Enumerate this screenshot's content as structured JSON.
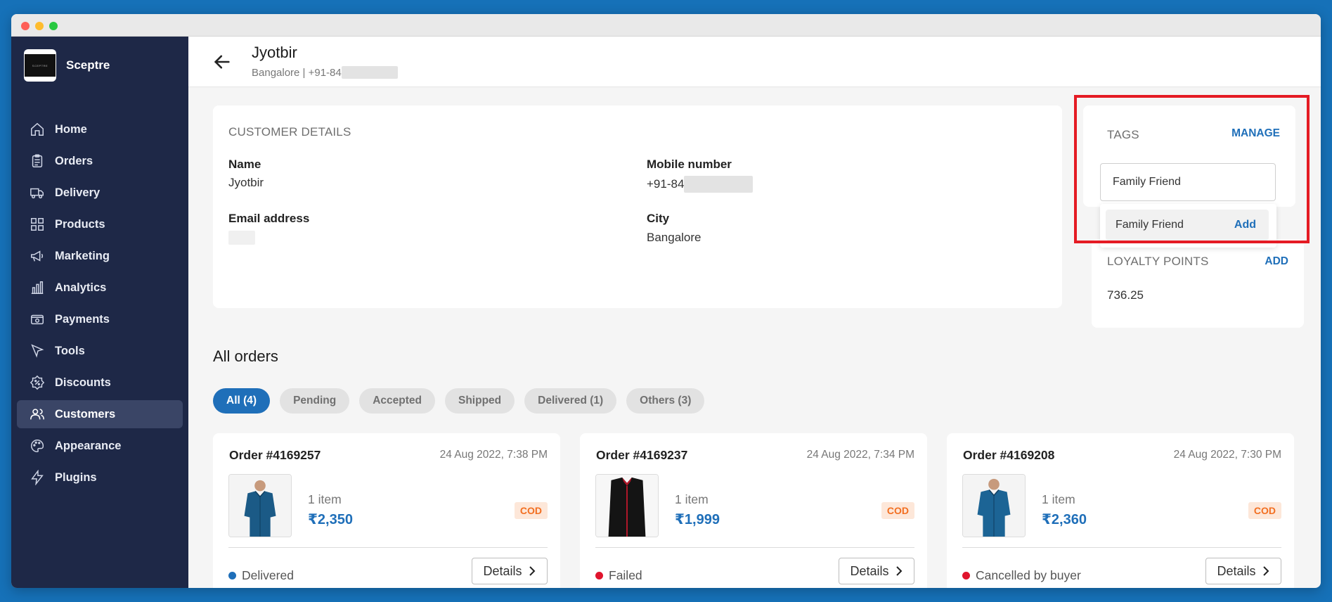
{
  "app": {
    "brand": "Sceptre",
    "logo_text": "SCEPTRE"
  },
  "sidebar": {
    "items": [
      {
        "label": "Home",
        "icon": "home-icon"
      },
      {
        "label": "Orders",
        "icon": "clipboard-icon"
      },
      {
        "label": "Delivery",
        "icon": "truck-icon"
      },
      {
        "label": "Products",
        "icon": "grid-icon"
      },
      {
        "label": "Marketing",
        "icon": "megaphone-icon"
      },
      {
        "label": "Analytics",
        "icon": "bar-chart-icon"
      },
      {
        "label": "Payments",
        "icon": "wallet-icon"
      },
      {
        "label": "Tools",
        "icon": "cursor-arrow-icon"
      },
      {
        "label": "Discounts",
        "icon": "discount-badge-icon"
      },
      {
        "label": "Customers",
        "icon": "users-icon",
        "active": true
      },
      {
        "label": "Appearance",
        "icon": "palette-icon"
      },
      {
        "label": "Plugins",
        "icon": "lightning-icon"
      }
    ]
  },
  "header": {
    "name": "Jyotbir",
    "subtitle": "Bangalore | +91-84"
  },
  "customer_details": {
    "section_title": "CUSTOMER DETAILS",
    "name_label": "Name",
    "name_value": "Jyotbir",
    "mobile_label": "Mobile number",
    "mobile_value": "+91-84",
    "email_label": "Email address",
    "city_label": "City",
    "city_value": "Bangalore"
  },
  "tags": {
    "title": "TAGS",
    "manage": "MANAGE",
    "input_value": "Family Friend",
    "suggestion": "Family Friend",
    "suggestion_action": "Add"
  },
  "loyalty": {
    "title": "LOYALTY POINTS",
    "action": "ADD",
    "value": "736.25"
  },
  "orders": {
    "title": "All orders",
    "filters": [
      "All (4)",
      "Pending",
      "Accepted",
      "Shipped",
      "Delivered (1)",
      "Others (3)"
    ],
    "list": [
      {
        "number": "Order #4169257",
        "date": "24 Aug 2022, 7:38 PM",
        "items": "1 item",
        "price": "₹2,350",
        "payment": "COD",
        "status": "Delivered",
        "status_color": "#1f6fb9",
        "details": "Details"
      },
      {
        "number": "Order #4169237",
        "date": "24 Aug 2022, 7:34 PM",
        "items": "1 item",
        "price": "₹1,999",
        "payment": "COD",
        "status": "Failed",
        "status_color": "#e0142d",
        "details": "Details"
      },
      {
        "number": "Order #4169208",
        "date": "24 Aug 2022, 7:30 PM",
        "items": "1 item",
        "price": "₹2,360",
        "payment": "COD",
        "status": "Cancelled by buyer",
        "status_color": "#e0142d",
        "details": "Details"
      }
    ]
  },
  "colors": {
    "accent": "#1f6fb9",
    "sidebar": "#1e2847",
    "highlight": "#e51b24",
    "cod_text": "#f26f21"
  }
}
